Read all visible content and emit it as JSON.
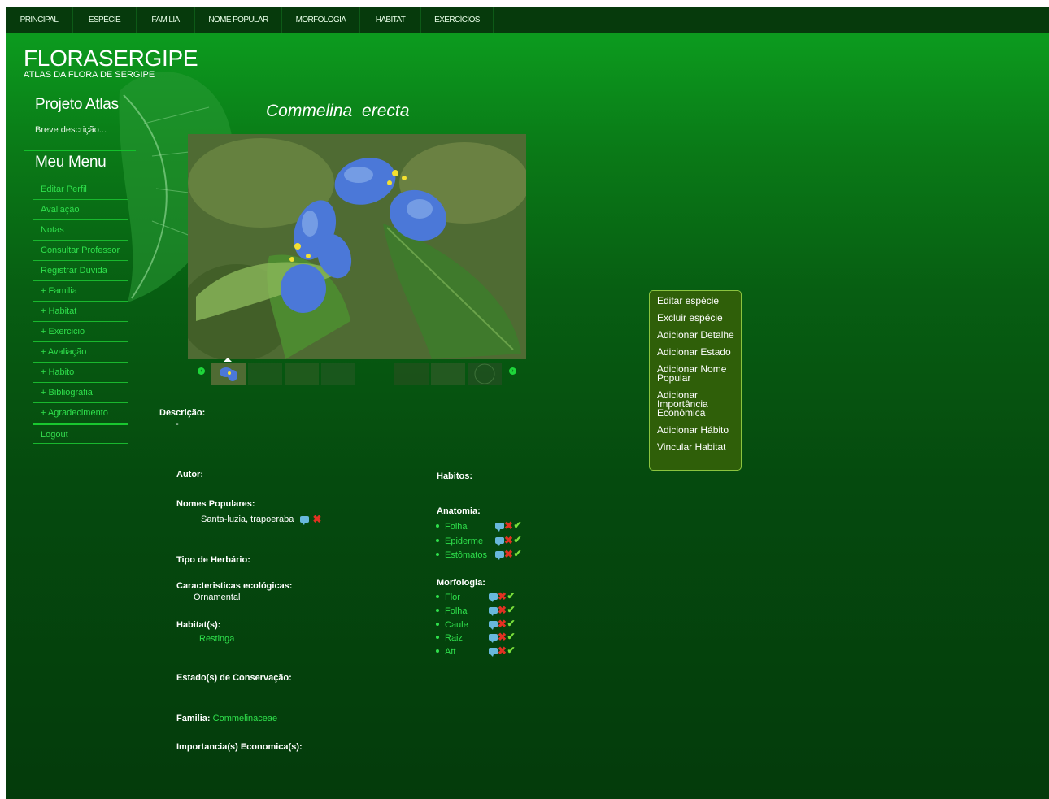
{
  "topnav": {
    "items": [
      "Principal",
      "Espécie",
      "Família",
      "Nome popular",
      "Morfologia",
      "Habitat",
      "Exercícios"
    ]
  },
  "header": {
    "title": "FLORASERGIPE",
    "subtitle": "ATLAS DA FLORA DE SERGIPE"
  },
  "sidebar": {
    "projeto_title": "Projeto Atlas",
    "projeto_desc": "Breve descrição...",
    "menu_title": "Meu Menu",
    "items": [
      "Editar Perfil",
      "Avaliação",
      "Notas",
      "Consultar Professor",
      "Registrar Duvida",
      "+ Familia",
      "+ Habitat",
      "+ Exercicio",
      "+ Avaliação",
      "+ Habito",
      "+ Bibliografia",
      "+ Agradecimento"
    ],
    "logout": "Logout"
  },
  "species": {
    "genus": "Commelina",
    "epithet": "erecta"
  },
  "gallery": {
    "prev_symbol": "‹",
    "next_symbol": "›"
  },
  "details": {
    "descricao_label": "Descrição:",
    "descricao_value": "-",
    "autor_label": "Autor:",
    "nomes_label": "Nomes Populares:",
    "nomes_value": "Santa-luzia, trapoeraba",
    "herbario_label": "Tipo de Herbário:",
    "caracteristicas_label": "Caracteristicas ecológicas:",
    "caracteristicas_value": "Ornamental",
    "habitat_label": "Habitat(s):",
    "habitat_value": "Restinga",
    "conservacao_label": "Estado(s) de Conservação:",
    "familia_label": "Familia:",
    "familia_value": "Commelinaceae",
    "importancia_label": "Importancia(s) Economica(s):"
  },
  "right_column": {
    "habitos_label": "Habitos:",
    "anatomia_label": "Anatomia:",
    "anatomia_items": [
      "Folha",
      "Epiderme",
      "Estômatos"
    ],
    "morfologia_label": "Morfologia:",
    "morfologia_items": [
      "Flor",
      "Folha",
      "Caule",
      "Raiz",
      "Att"
    ]
  },
  "actions": {
    "items": [
      "Editar espécie",
      "Excluir espécie",
      "Adicionar Detalhe",
      "Adicionar Estado",
      "Adicionar Nome Popular",
      "Adicionar Importância Econômica",
      "Adicionar Hábito",
      "Vincular Habitat"
    ]
  },
  "icons": {
    "comment": "comment-icon",
    "delete": "delete-icon",
    "approve": "check-icon"
  },
  "colors": {
    "background_dark": "#043b0b",
    "nav_bar": "#063a0c",
    "link_green": "#2fe04c",
    "panel_bg": "#2f5f09",
    "panel_border": "#8bc43f",
    "delete_red": "#e23122",
    "check_green": "#7be13b",
    "comment_blue": "#68b8dc"
  }
}
